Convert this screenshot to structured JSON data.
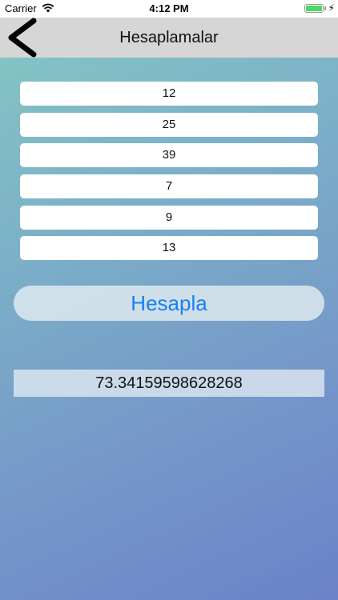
{
  "status_bar": {
    "carrier": "Carrier",
    "time": "4:12 PM",
    "wifi_icon": "wifi-icon",
    "battery_icon": "battery-icon",
    "battery_level": 1.0,
    "charging_icon": "bolt-icon"
  },
  "nav_bar": {
    "back_icon": "chevron-left-icon",
    "title": "Hesaplamalar"
  },
  "inputs": [
    {
      "value": "12"
    },
    {
      "value": "25"
    },
    {
      "value": "39"
    },
    {
      "value": "7"
    },
    {
      "value": "9"
    },
    {
      "value": "13"
    }
  ],
  "calculate_button": {
    "label": "Hesapla",
    "text_color": "#1a7ff0"
  },
  "result": {
    "value": "73.34159598628268"
  },
  "colors": {
    "nav_background": "#d6d6d6",
    "gradient_start": "#86c8c2",
    "gradient_end": "#6b82c8"
  }
}
